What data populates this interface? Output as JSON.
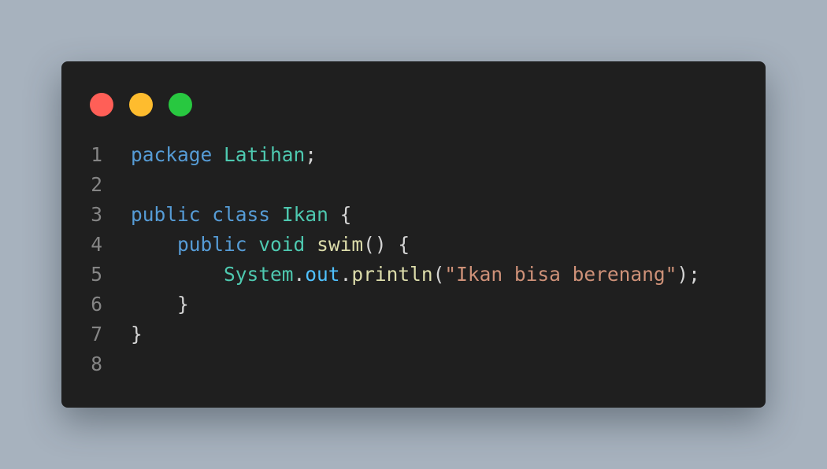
{
  "window": {
    "controls": [
      {
        "name": "close",
        "color": "#ff5f57"
      },
      {
        "name": "minimize",
        "color": "#febc2e"
      },
      {
        "name": "maximize",
        "color": "#28c840"
      }
    ]
  },
  "code": {
    "language": "java",
    "colors": {
      "keyword": "#569cd6",
      "type": "#4ec9b0",
      "function": "#dcdcaa",
      "property": "#4fc1ff",
      "string": "#ce9178",
      "punctuation": "#d4d4d4",
      "line_number": "#858585"
    },
    "lines": [
      {
        "number": "1",
        "tokens": [
          {
            "text": "package",
            "type": "kw"
          },
          {
            "text": " ",
            "type": "punc"
          },
          {
            "text": "Latihan",
            "type": "type"
          },
          {
            "text": ";",
            "type": "punc"
          }
        ]
      },
      {
        "number": "2",
        "tokens": []
      },
      {
        "number": "3",
        "tokens": [
          {
            "text": "public",
            "type": "kw"
          },
          {
            "text": " ",
            "type": "punc"
          },
          {
            "text": "class",
            "type": "kw"
          },
          {
            "text": " ",
            "type": "punc"
          },
          {
            "text": "Ikan",
            "type": "type"
          },
          {
            "text": " {",
            "type": "punc"
          }
        ]
      },
      {
        "number": "4",
        "tokens": [
          {
            "text": "    ",
            "type": "punc"
          },
          {
            "text": "public",
            "type": "kw"
          },
          {
            "text": " ",
            "type": "punc"
          },
          {
            "text": "void",
            "type": "type"
          },
          {
            "text": " ",
            "type": "punc"
          },
          {
            "text": "swim",
            "type": "fn"
          },
          {
            "text": "() {",
            "type": "punc"
          }
        ]
      },
      {
        "number": "5",
        "tokens": [
          {
            "text": "        ",
            "type": "punc"
          },
          {
            "text": "System",
            "type": "type"
          },
          {
            "text": ".",
            "type": "punc"
          },
          {
            "text": "out",
            "type": "prop"
          },
          {
            "text": ".",
            "type": "punc"
          },
          {
            "text": "println",
            "type": "fn"
          },
          {
            "text": "(",
            "type": "punc"
          },
          {
            "text": "\"Ikan bisa berenang\"",
            "type": "str"
          },
          {
            "text": ");",
            "type": "punc"
          }
        ]
      },
      {
        "number": "6",
        "tokens": [
          {
            "text": "    }",
            "type": "punc"
          }
        ]
      },
      {
        "number": "7",
        "tokens": [
          {
            "text": "}",
            "type": "punc"
          }
        ]
      },
      {
        "number": "8",
        "tokens": []
      }
    ]
  }
}
